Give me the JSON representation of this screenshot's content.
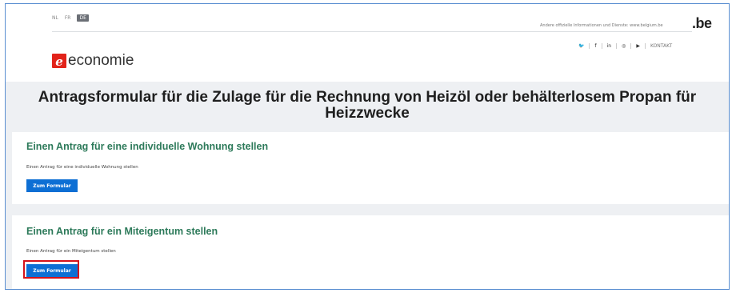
{
  "header": {
    "languages": [
      {
        "code": "NL",
        "active": false
      },
      {
        "code": "FR",
        "active": false
      },
      {
        "code": "DE",
        "active": true
      }
    ],
    "federal_text": "Andere offizielle Informationen und Dienste: www.belgium.be",
    "be_logo": ".be",
    "social": [
      "twitter-icon",
      "facebook-icon",
      "linkedin-icon",
      "instagram-icon",
      "youtube-icon"
    ],
    "social_glyphs": [
      "🐦",
      "f",
      "in",
      "◎",
      "▶"
    ],
    "contact_label": "KONTAKT",
    "brand": {
      "mark": "e",
      "text": "economie",
      "accent_color": "#e2231a"
    }
  },
  "page_title": "Antragsformular für die Zulage für die Rechnung von Heizöl oder behälterlosem Propan für Heizzwecke",
  "sections": [
    {
      "title": "Einen Antrag für eine individuelle Wohnung stellen",
      "description": "Einen Antrag für eine individuelle Wohnung stellen",
      "button_label": "Zum Formular"
    },
    {
      "title": "Einen Antrag für ein Miteigentum stellen",
      "description": "Einen Antrag für ein Miteigentum stellen",
      "button_label": "Zum Formular"
    }
  ],
  "colors": {
    "section_title": "#2d7a5a",
    "button": "#0d6fd4",
    "highlight": "#d4121a"
  }
}
